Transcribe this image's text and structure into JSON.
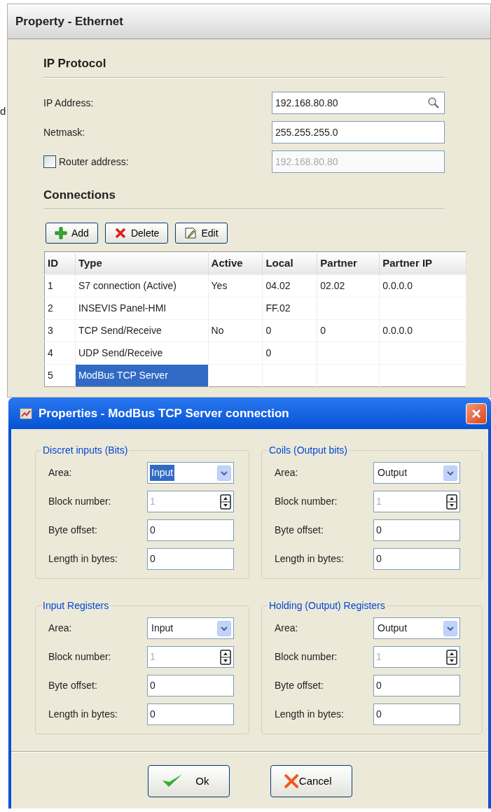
{
  "background_text": "d",
  "panel": {
    "title": "Property - Ethernet",
    "ip_section": {
      "heading": "IP Protocol",
      "fields": [
        {
          "kind": "search",
          "label": "IP Address:",
          "value": "192.168.80.80",
          "disabled": false
        },
        {
          "kind": "text",
          "label": "Netmask:",
          "value": "255.255.255.0",
          "disabled": false
        },
        {
          "kind": "checkbox",
          "label": "Router address:",
          "checked": false,
          "value": "192.168.80.80",
          "disabled": true
        }
      ]
    },
    "connections": {
      "heading": "Connections",
      "toolbar": [
        {
          "kind": "add",
          "label": "Add"
        },
        {
          "kind": "delete",
          "label": "Delete"
        },
        {
          "kind": "edit",
          "label": "Edit"
        }
      ],
      "table": {
        "columns": [
          "ID",
          "Type",
          "Active",
          "Local",
          "Partner",
          "Partner IP"
        ],
        "rows": [
          {
            "cells": [
              "1",
              "S7 connection (Active)",
              "Yes",
              "04.02",
              "02.02",
              "0.0.0.0"
            ],
            "selected": false
          },
          {
            "cells": [
              "2",
              "INSEVIS Panel-HMI",
              "",
              "FF.02",
              "",
              ""
            ],
            "selected": false
          },
          {
            "cells": [
              "3",
              "TCP Send/Receive",
              "No",
              "0",
              "0",
              "0.0.0.0"
            ],
            "selected": false
          },
          {
            "cells": [
              "4",
              "UDP Send/Receive",
              "",
              "0",
              "",
              ""
            ],
            "selected": false
          },
          {
            "cells": [
              "5",
              "ModBus TCP Server",
              "",
              "",
              "",
              ""
            ],
            "selected": true
          }
        ]
      }
    }
  },
  "dialog": {
    "title": "Properties - ModBus TCP Server connection",
    "groups": [
      {
        "title": "Discret inputs (Bits)",
        "fields": [
          {
            "kind": "select",
            "label": "Area:",
            "value": "Input",
            "focused": true
          },
          {
            "kind": "spin",
            "label": "Block number:",
            "value": "1",
            "disabled": true
          },
          {
            "kind": "text",
            "label": "Byte offset:",
            "value": "0"
          },
          {
            "kind": "text",
            "label": "Length in bytes:",
            "value": "0"
          }
        ]
      },
      {
        "title": "Coils (Output bits)",
        "fields": [
          {
            "kind": "select",
            "label": "Area:",
            "value": "Output",
            "focused": false
          },
          {
            "kind": "spin",
            "label": "Block number:",
            "value": "1",
            "disabled": true
          },
          {
            "kind": "text",
            "label": "Byte offset:",
            "value": "0"
          },
          {
            "kind": "text",
            "label": "Length in bytes:",
            "value": "0"
          }
        ]
      },
      {
        "title": "Input Registers",
        "fields": [
          {
            "kind": "select",
            "label": "Area:",
            "value": "Input",
            "focused": false
          },
          {
            "kind": "spin",
            "label": "Block number:",
            "value": "1",
            "disabled": true
          },
          {
            "kind": "text",
            "label": "Byte offset:",
            "value": "0"
          },
          {
            "kind": "text",
            "label": "Length in bytes:",
            "value": "0"
          }
        ]
      },
      {
        "title": "Holding (Output) Registers",
        "fields": [
          {
            "kind": "select",
            "label": "Area:",
            "value": "Output",
            "focused": false
          },
          {
            "kind": "spin",
            "label": "Block number:",
            "value": "1",
            "disabled": true
          },
          {
            "kind": "text",
            "label": "Byte offset:",
            "value": "0"
          },
          {
            "kind": "text",
            "label": "Length in bytes:",
            "value": "0"
          }
        ]
      }
    ],
    "buttons": [
      {
        "kind": "ok",
        "label": "Ok"
      },
      {
        "kind": "cancel",
        "label": "Cancel"
      }
    ]
  }
}
